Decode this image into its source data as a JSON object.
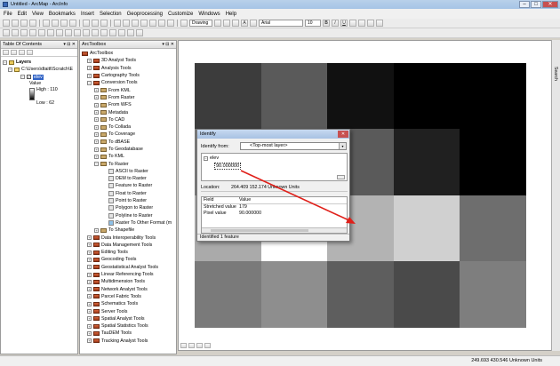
{
  "window": {
    "title": "Untitled - ArcMap - ArcInfo",
    "min": "–",
    "max": "□",
    "close": "✕"
  },
  "menu": [
    "File",
    "Edit",
    "View",
    "Bookmarks",
    "Insert",
    "Selection",
    "Geoprocessing",
    "Customize",
    "Windows",
    "Help"
  ],
  "toolbar": {
    "drawing_label": "Drawing",
    "font_name": "Arial",
    "font_size": "10",
    "bold": "B",
    "italic": "I",
    "underline": "U",
    "text_tool": "A"
  },
  "toc": {
    "title": "Table Of Contents",
    "layers_label": "Layers",
    "folder_path": "C:\\Users\\dtaitt\\Scratch\\E",
    "layer_name": "elev",
    "value_label": "Value",
    "high_label": "High : 110",
    "low_label": "Low : 62"
  },
  "toolbox": {
    "title": "ArcToolbox",
    "root": "ArcToolbox",
    "toolsets_top": [
      "3D Analyst Tools",
      "Analysis Tools",
      "Cartography Tools",
      "Conversion Tools"
    ],
    "conversion_children": [
      "From KML",
      "From Raster",
      "From WFS",
      "Metadata",
      "To CAD",
      "To Collada",
      "To Coverage",
      "To dBASE",
      "To Geodatabase",
      "To KML",
      "To Raster"
    ],
    "to_raster_tools": [
      "ASCII to Raster",
      "DEM to Raster",
      "Feature to Raster",
      "Float to Raster",
      "Point to Raster",
      "Polygon to Raster",
      "Polyline to Raster",
      "Raster To Other Format (m"
    ],
    "to_shapefile": "To Shapefile",
    "toolsets_bottom": [
      "Data Interoperability Tools",
      "Data Management Tools",
      "Editing Tools",
      "Geocoding Tools",
      "Geostatistical Analyst Tools",
      "Linear Referencing Tools",
      "Multidimension Tools",
      "Network Analyst Tools",
      "Parcel Fabric Tools",
      "Schematics Tools",
      "Server Tools",
      "Spatial Analyst Tools",
      "Spatial Statistics Tools",
      "TauDEM Tools",
      "Tracking Analyst Tools"
    ]
  },
  "identify": {
    "title": "Identify",
    "from_label": "Identify from:",
    "from_value": "<Top-most layer>",
    "tree_layer": "elev",
    "tree_value": "90.000000",
    "location_label": "Location:",
    "location_value": "264.409  152.174 Unknown Units",
    "col_field": "Field",
    "col_value": "Value",
    "rows": [
      {
        "field": "Stretched value",
        "value": "179"
      },
      {
        "field": "Pixel value",
        "value": "90.000000"
      }
    ],
    "status": "Identified 1 feature"
  },
  "raster_grays": [
    [
      "#3c3c3c",
      "#5a5a5a",
      "#111111",
      "#000000",
      "#000000"
    ],
    [
      "#7a7a7a",
      "#7a7a7a",
      "#5a5a5a",
      "#202020",
      "#000000"
    ],
    [
      "#aaaaaa",
      "#ffffff",
      "#b3b3b3",
      "#d0d0d0",
      "#6e6e6e"
    ],
    [
      "#7a7a7a",
      "#8e8e8e",
      "#5e5e5e",
      "#4a4a4a",
      "#7e7e7e"
    ]
  ],
  "arrow_color": "#e0201a",
  "side_tab": "Search",
  "status_coords": "249.693  430.546 Unknown Units"
}
